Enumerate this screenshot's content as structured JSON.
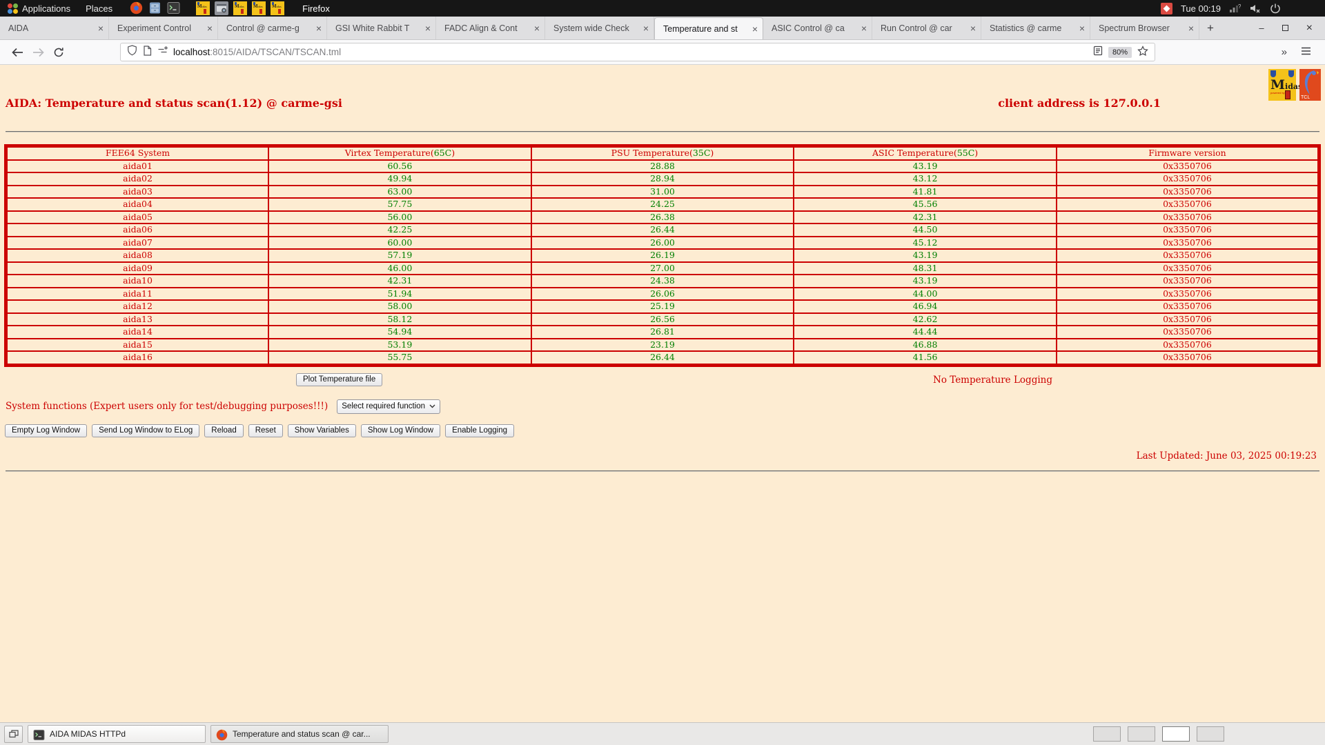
{
  "desktop": {
    "menus": [
      {
        "label": "Applications"
      },
      {
        "label": "Places"
      }
    ],
    "launcher_icons": [
      "firefox-icon",
      "files-icon",
      "terminal-icon"
    ],
    "pinned_icons": [
      "midas-icon",
      "screenshot-icon",
      "midas-icon",
      "midas-icon",
      "midas-icon"
    ],
    "focused_app": "Firefox",
    "clock": "Tue 00:19"
  },
  "browser": {
    "tabs": [
      {
        "title": "AIDA",
        "active": false
      },
      {
        "title": "Experiment Control",
        "active": false
      },
      {
        "title": "Control @ carme-g",
        "active": false
      },
      {
        "title": "GSI White Rabbit T",
        "active": false
      },
      {
        "title": "FADC Align & Cont",
        "active": false
      },
      {
        "title": "System wide Check",
        "active": false
      },
      {
        "title": "Temperature and st",
        "active": true
      },
      {
        "title": "ASIC Control @ ca",
        "active": false
      },
      {
        "title": "Run Control @ car",
        "active": false
      },
      {
        "title": "Statistics @ carme",
        "active": false
      },
      {
        "title": "Spectrum Browser",
        "active": false
      }
    ],
    "new_tab_label": "+",
    "url_host": "localhost",
    "url_rest": ":8015/AIDA/TSCAN/TSCAN.tml",
    "zoom_level": "80%"
  },
  "page": {
    "title": "AIDA: Temperature and status scan(1.12) @ carme-gsi",
    "client_address": "client address is 127.0.0.1",
    "colors": {
      "background": "#fdecd2",
      "red": "#cc0000",
      "green": "#008000"
    },
    "table": {
      "headers": [
        {
          "pre": "FEE64 System",
          "limit": "",
          "post": ""
        },
        {
          "pre": "Virtex Temperature(",
          "limit": "65C",
          "post": ")"
        },
        {
          "pre": "PSU Temperature(",
          "limit": "35C",
          "post": ")"
        },
        {
          "pre": "ASIC Temperature(",
          "limit": "55C",
          "post": ")"
        },
        {
          "pre": "Firmware version",
          "limit": "",
          "post": ""
        }
      ],
      "rows": [
        {
          "fee64": "aida01",
          "virtex": "60.56",
          "psu": "28.88",
          "asic": "43.19",
          "firmware": "0x3350706"
        },
        {
          "fee64": "aida02",
          "virtex": "49.94",
          "psu": "28.94",
          "asic": "43.12",
          "firmware": "0x3350706"
        },
        {
          "fee64": "aida03",
          "virtex": "63.00",
          "psu": "31.00",
          "asic": "41.81",
          "firmware": "0x3350706"
        },
        {
          "fee64": "aida04",
          "virtex": "57.75",
          "psu": "24.25",
          "asic": "45.56",
          "firmware": "0x3350706"
        },
        {
          "fee64": "aida05",
          "virtex": "56.00",
          "psu": "26.38",
          "asic": "42.31",
          "firmware": "0x3350706"
        },
        {
          "fee64": "aida06",
          "virtex": "42.25",
          "psu": "26.44",
          "asic": "44.50",
          "firmware": "0x3350706"
        },
        {
          "fee64": "aida07",
          "virtex": "60.00",
          "psu": "26.00",
          "asic": "45.12",
          "firmware": "0x3350706"
        },
        {
          "fee64": "aida08",
          "virtex": "57.19",
          "psu": "26.19",
          "asic": "43.19",
          "firmware": "0x3350706"
        },
        {
          "fee64": "aida09",
          "virtex": "46.00",
          "psu": "27.00",
          "asic": "48.31",
          "firmware": "0x3350706"
        },
        {
          "fee64": "aida10",
          "virtex": "42.31",
          "psu": "24.38",
          "asic": "43.19",
          "firmware": "0x3350706"
        },
        {
          "fee64": "aida11",
          "virtex": "51.94",
          "psu": "26.06",
          "asic": "44.00",
          "firmware": "0x3350706"
        },
        {
          "fee64": "aida12",
          "virtex": "58.00",
          "psu": "25.19",
          "asic": "46.94",
          "firmware": "0x3350706"
        },
        {
          "fee64": "aida13",
          "virtex": "58.12",
          "psu": "26.56",
          "asic": "42.62",
          "firmware": "0x3350706"
        },
        {
          "fee64": "aida14",
          "virtex": "54.94",
          "psu": "26.81",
          "asic": "44.44",
          "firmware": "0x3350706"
        },
        {
          "fee64": "aida15",
          "virtex": "53.19",
          "psu": "23.19",
          "asic": "46.88",
          "firmware": "0x3350706"
        },
        {
          "fee64": "aida16",
          "virtex": "55.75",
          "psu": "26.44",
          "asic": "41.56",
          "firmware": "0x3350706"
        }
      ]
    },
    "plot_button": "Plot Temperature file",
    "logging_status": "No Temperature Logging",
    "system_functions_label": "System functions (Expert users only for test/debugging purposes!!!)",
    "function_select": "Select required function",
    "action_buttons": [
      "Empty Log Window",
      "Send Log Window to ELog",
      "Reload",
      "Reset",
      "Show Variables",
      "Show Log Window",
      "Enable Logging"
    ],
    "last_updated": "Last Updated: June 03, 2025 00:19:23"
  },
  "taskbar": {
    "tasks": [
      {
        "icon": "terminal-icon",
        "title": "AIDA MIDAS HTTPd"
      },
      {
        "icon": "firefox-icon",
        "title": "Temperature and status scan @ car..."
      }
    ],
    "workspaces": {
      "count": 4,
      "active": 3
    }
  }
}
